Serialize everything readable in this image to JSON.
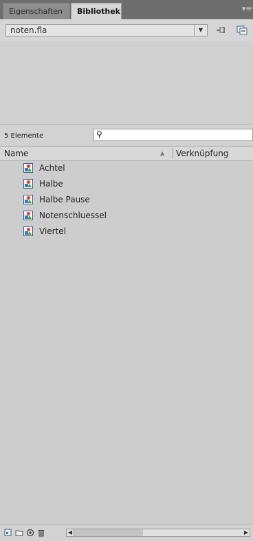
{
  "tabs": [
    {
      "label": "Eigenschaften",
      "active": false
    },
    {
      "label": "Bibliothek",
      "active": true
    }
  ],
  "panel_menu_icon": "panel-menu-icon",
  "library": {
    "selected": "noten.fla",
    "pin_icon": "pin-icon",
    "new_library_icon": "new-library-panel-icon"
  },
  "count_label": "5 Elemente",
  "search": {
    "value": "",
    "icon": "search-icon"
  },
  "columns": {
    "name": "Name",
    "linkage": "Verknüpfung"
  },
  "items": [
    {
      "label": "Achtel",
      "icon": "graphic-symbol-icon"
    },
    {
      "label": "Halbe",
      "icon": "graphic-symbol-icon"
    },
    {
      "label": "Halbe Pause",
      "icon": "graphic-symbol-icon"
    },
    {
      "label": "Notenschluessel",
      "icon": "graphic-symbol-icon"
    },
    {
      "label": "Viertel",
      "icon": "graphic-symbol-icon"
    }
  ],
  "toolbar": [
    "new-symbol-icon",
    "new-folder-icon",
    "properties-icon",
    "delete-icon"
  ],
  "colors": {
    "tabbar": "#6e6e6e",
    "panel": "#cdcdcd",
    "icon_border": "#3c5a86"
  }
}
